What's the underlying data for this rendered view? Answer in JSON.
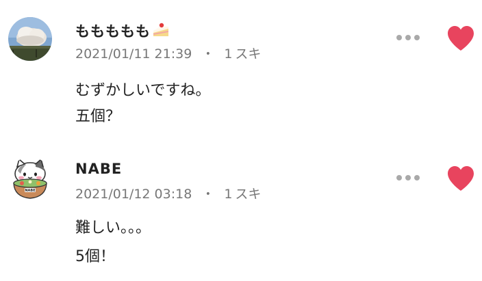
{
  "comments": [
    {
      "user_name": "ももももも",
      "avatar_icon": "cloud-landscape-avatar",
      "name_emoji_icon": "shortcake-icon",
      "date": "2021/01/11 21:39",
      "separator": "・",
      "likes": "1",
      "likes_label": "スキ",
      "liked": true,
      "body": [
        "むずかしいですね。",
        "五個？"
      ]
    },
    {
      "user_name": "NABE",
      "avatar_icon": "cat-nabe-avatar",
      "date": "2021/01/12 03:18",
      "separator": "・",
      "likes": "1",
      "likes_label": "スキ",
      "liked": true,
      "body": [
        "難しい。。。",
        "5個！"
      ]
    }
  ],
  "colors": {
    "heart": "#e8445e",
    "meta_text": "#777777",
    "more_dots": "#a9a9a9"
  }
}
